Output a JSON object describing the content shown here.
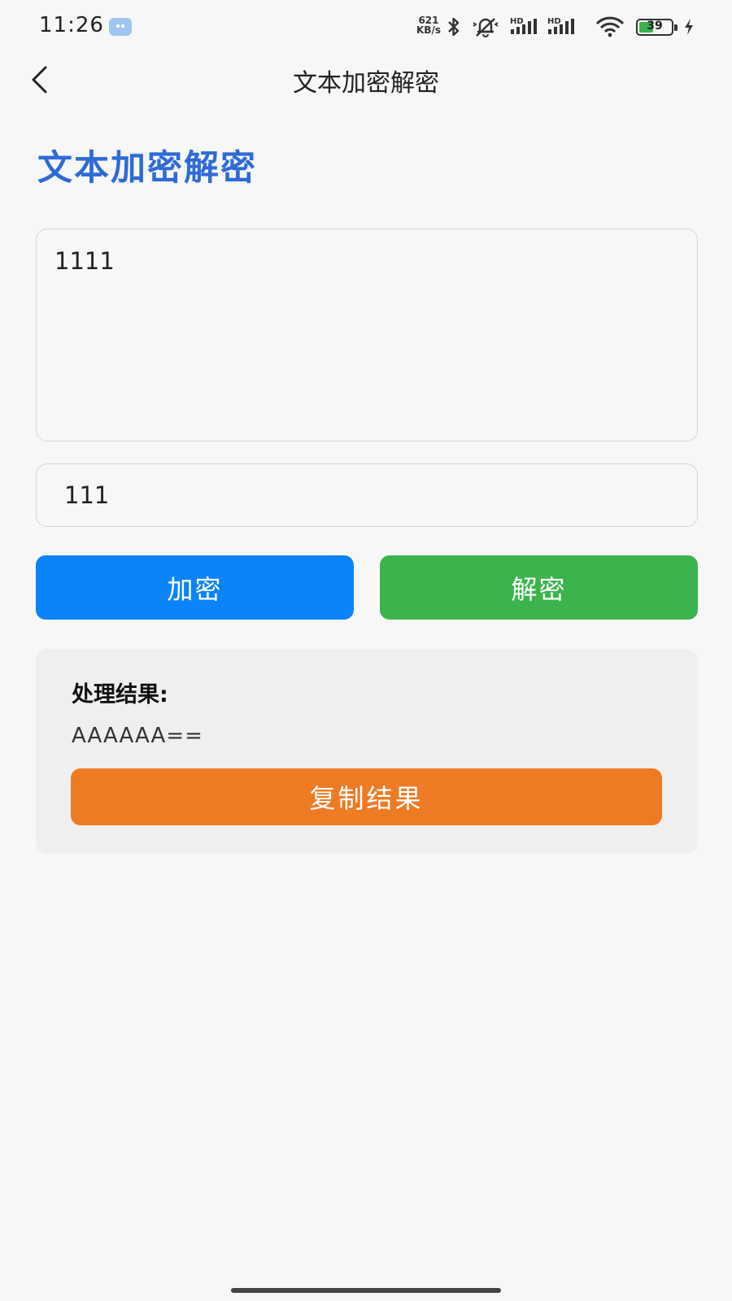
{
  "status_bar": {
    "time": "11:26",
    "net_speed_value": "621",
    "net_speed_unit": "KB/s",
    "signal_label_1": "HD",
    "signal_label_2": "HD",
    "battery_level": "39"
  },
  "nav": {
    "title": "文本加密解密"
  },
  "heading": "文本加密解密",
  "inputs": {
    "text_value": "1111",
    "key_value": "111"
  },
  "buttons": {
    "encrypt_label": "加密",
    "decrypt_label": "解密"
  },
  "result": {
    "label": "处理结果:",
    "value": "AAAAAA==",
    "copy_label": "复制结果"
  },
  "colors": {
    "heading": "#2f6bd7",
    "encrypt": "#0b84f9",
    "decrypt": "#3cb44e",
    "copy": "#ed7b24",
    "battery": "#3cb24a"
  }
}
